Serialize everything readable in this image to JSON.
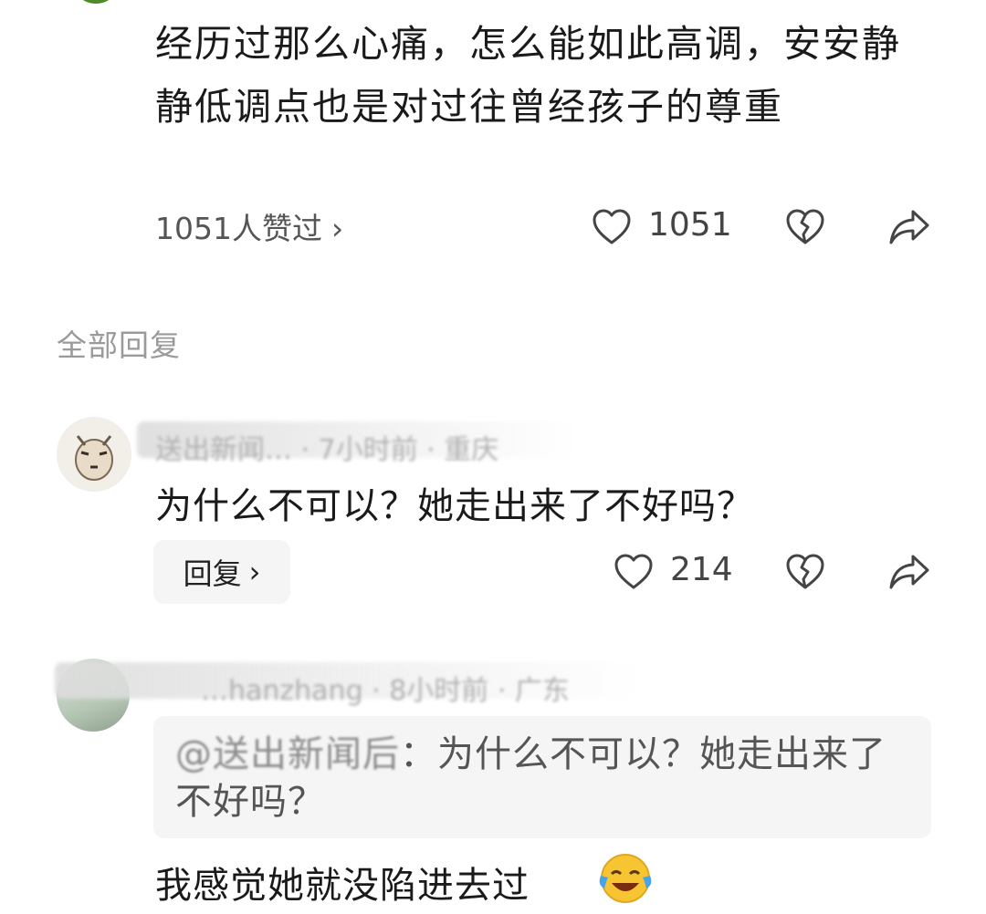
{
  "post": {
    "text": "经历过那么心痛，怎么能如此高调，安安静静低调点也是对过往曾经孩子的尊重",
    "likes_summary": "1051人赞过",
    "like_count": "1051"
  },
  "section_title": "全部回复",
  "replies": [
    {
      "meta": "送出新闻… · 7小时前 · 重庆",
      "text": "为什么不可以？她走出来了不好吗？",
      "reply_label": "回复",
      "like_count": "214"
    },
    {
      "meta": "…hanzhang · 8小时前 · 广东",
      "quote_mention": "@送出新闻后",
      "quote_text": "：为什么不可以？她走出来了不好吗？",
      "text": "我感觉她就没陷进去过"
    }
  ],
  "icons": {
    "like": "heart-icon",
    "dislike": "broken-heart-icon",
    "share": "share-icon",
    "chevron": "chevron-right-icon",
    "emoji": "laughing-crying-emoji"
  },
  "colors": {
    "text": "#1a1a1a",
    "muted": "#9a9a9a",
    "button_bg": "#f5f5f5"
  }
}
